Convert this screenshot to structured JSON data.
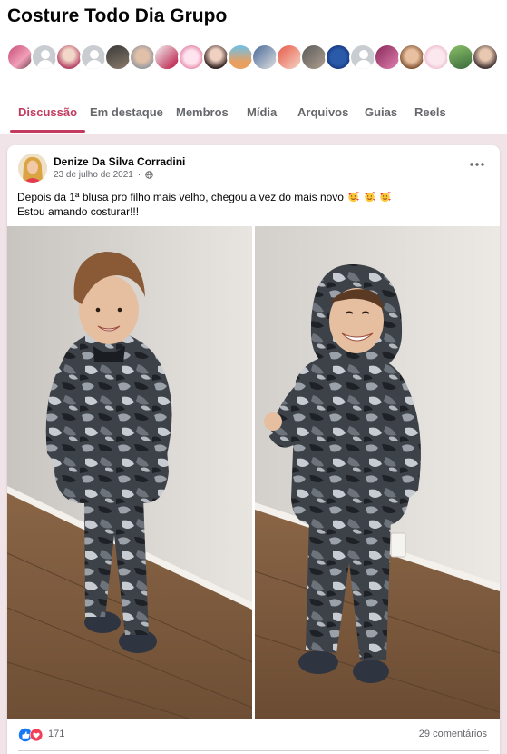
{
  "group": {
    "title": "Costure Todo Dia Grupo"
  },
  "members_preview": {
    "avatars": [
      "member-photo-1",
      "default-avatar",
      "member-photo-3",
      "default-avatar",
      "member-photo-5",
      "member-photo-6",
      "member-photo-7",
      "member-photo-8",
      "member-photo-9",
      "member-photo-10",
      "member-photo-11",
      "member-photo-12",
      "member-photo-13",
      "member-photo-14",
      "default-avatar",
      "member-photo-16",
      "member-photo-17",
      "member-photo-18",
      "member-photo-19",
      "member-photo-20"
    ]
  },
  "tabs": [
    {
      "label": "Discussão",
      "active": true
    },
    {
      "label": "Em destaque",
      "active": false
    },
    {
      "label": "Membros",
      "active": false
    },
    {
      "label": "Mídia",
      "active": false
    },
    {
      "label": "Arquivos",
      "active": false
    },
    {
      "label": "Guias",
      "active": false
    },
    {
      "label": "Reels",
      "active": false
    }
  ],
  "post": {
    "author": "Denize Da Silva Corradini",
    "date": "23 de julho de 2021",
    "separator": "·",
    "audience_icon": "globe-icon",
    "options_icon": "more-options-icon",
    "text_line1": "Depois da 1ª blusa pro filho mais velho, chegou a vez do mais novo",
    "text_line1_emojis": [
      "smiling-face-with-hearts-emoji",
      "smiling-face-with-hearts-emoji",
      "smiling-face-with-hearts-emoji"
    ],
    "text_line2": "Estou amando costurar!!!",
    "photos": [
      "photo-boy-camo-outfit-hands-in-pockets",
      "photo-boy-camo-hoodie-up-waving"
    ],
    "reactions": [
      "like-icon",
      "love-icon"
    ],
    "reaction_count": "171",
    "comment_count": "29 comentários"
  },
  "colors": {
    "accent": "#c23a5f",
    "page_bg": "#f0e4e8",
    "secondary_text": "#65676b",
    "like_blue": "#1877f2",
    "love_red": "#f33e58"
  }
}
